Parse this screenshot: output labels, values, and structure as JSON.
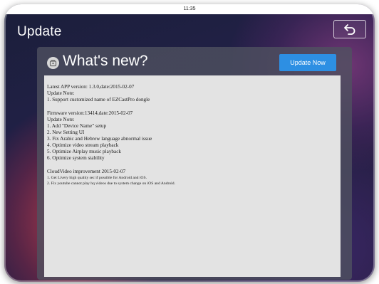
{
  "status_bar": {
    "time": "11:35"
  },
  "header": {
    "title": "Update",
    "back_icon": "back-arrow-icon"
  },
  "panel": {
    "icon": "update-package-icon",
    "title": "What's new?",
    "update_button_label": "Update Now",
    "sections": [
      {
        "lines": [
          "Latest APP version: 1.3.0,date:2015-02-07",
          "Update Note:",
          "1. Support customized name of EZCastPro dongle"
        ]
      },
      {
        "lines": [
          "Firmware version:13414,date:2015-02-07",
          "Update Note:",
          "1. Add \"Device Name\" setup",
          "2. New Setting UI",
          "3. Fix Arabic and Hebrew language abnormal issue",
          "4. Optimize video stream playback",
          "5. Optimize Airplay music playback",
          "6. Optimize system stability"
        ]
      },
      {
        "lines": [
          "CloudVideo improvement 2015-02-07"
        ],
        "small_lines": [
          "1. Get Livery high quality sec if possible for Android and iOS.",
          "2. Fix youtube cannot play hq videos due to system change on iOS and Android."
        ]
      }
    ]
  },
  "colors": {
    "accent_button": "#2d8fe3",
    "notes_background": "#e3e3e3"
  }
}
